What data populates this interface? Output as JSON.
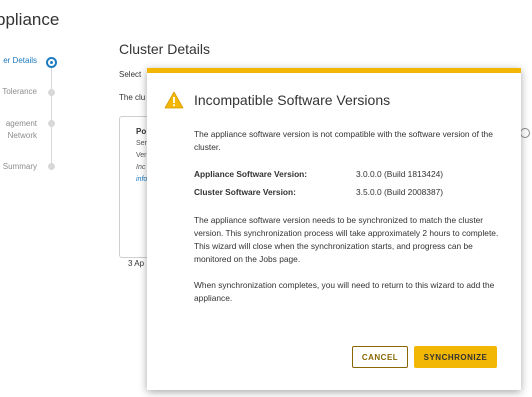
{
  "wizard": {
    "title": "ppliance"
  },
  "steps": [
    {
      "label": "er Details",
      "active": true
    },
    {
      "label": "Tolerance",
      "active": false
    },
    {
      "label_line1": "agement",
      "label_line2": "Network",
      "active": false
    },
    {
      "label": "Summary",
      "active": false
    }
  ],
  "background": {
    "heading": "Cluster Details",
    "select_text": "Select",
    "cluster_text": "The clu",
    "card": {
      "title": "Po",
      "line1": "Ser",
      "line2": "Ver",
      "line3": "Inc",
      "line4": "info"
    },
    "count_text": "3 Ap"
  },
  "modal": {
    "title": "Incompatible Software Versions",
    "intro": "The appliance software version is not compatible with the software version of the cluster.",
    "appliance_label": "Appliance Software Version:",
    "appliance_value": "3.0.0.0 (Build 1813424)",
    "cluster_label": "Cluster Software Version:",
    "cluster_value": "3.5.0.0 (Build 2008387)",
    "sync_note": "The appliance software version needs to be synchronized to match the cluster version. This synchronization process will take approximately 2 hours to complete. This wizard will close when the synchronization starts, and progress can be monitored on the Jobs page.",
    "return_note": "When synchronization completes, you will need to return to this wizard to add the appliance.",
    "cancel_label": "CANCEL",
    "sync_label": "SYNCHRONIZE"
  },
  "colors": {
    "accent": "#f2b705",
    "link": "#1d7bc0",
    "cancel_text": "#8a6700"
  },
  "icons": {
    "warning": "warning-triangle-icon"
  }
}
